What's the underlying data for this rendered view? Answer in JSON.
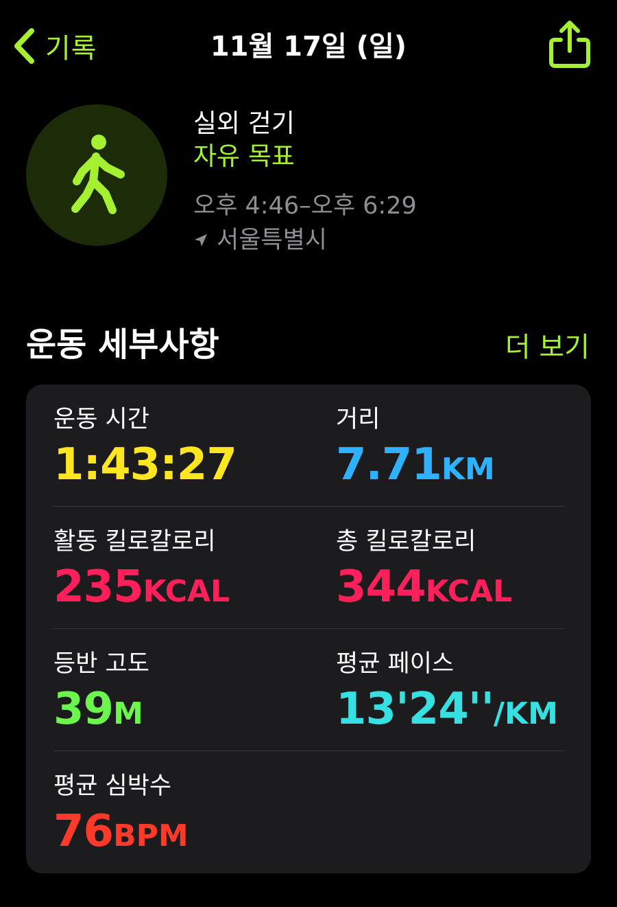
{
  "nav": {
    "back_label": "기록",
    "title": "11월 17일 (일)"
  },
  "workout": {
    "title": "실외 걷기",
    "goal": "자유 목표",
    "time_range": "오후 4:46–오후 6:29",
    "location": "서울특별시"
  },
  "section": {
    "title": "운동 세부사항",
    "more_label": "더 보기"
  },
  "metrics": {
    "duration": {
      "label": "운동 시간",
      "value": "1:43:27",
      "unit": "",
      "color": "#ffe620"
    },
    "distance": {
      "label": "거리",
      "value": "7.71",
      "unit": "KM",
      "color": "#2eb2ff"
    },
    "active_kcal": {
      "label": "활동 킬로칼로리",
      "value": "235",
      "unit": "KCAL",
      "color": "#ff1f5a"
    },
    "total_kcal": {
      "label": "총 킬로칼로리",
      "value": "344",
      "unit": "KCAL",
      "color": "#ff1f5a"
    },
    "elevation": {
      "label": "등반 고도",
      "value": "39",
      "unit": "M",
      "color": "#6cf54c"
    },
    "pace": {
      "label": "평균 페이스",
      "value": "13'24''",
      "unit": "/KM",
      "color": "#36e0e0"
    },
    "heart_rate": {
      "label": "평균 심박수",
      "value": "76",
      "unit": "BPM",
      "color": "#ff3a2a"
    }
  },
  "colors": {
    "accent": "#a6f032",
    "background": "#000000",
    "card": "#1c1c1e",
    "secondary_text": "#8e8e93"
  },
  "icons": {
    "back": "chevron-left-icon",
    "share": "share-icon",
    "workout": "walking-figure-icon",
    "location": "location-arrow-icon"
  }
}
